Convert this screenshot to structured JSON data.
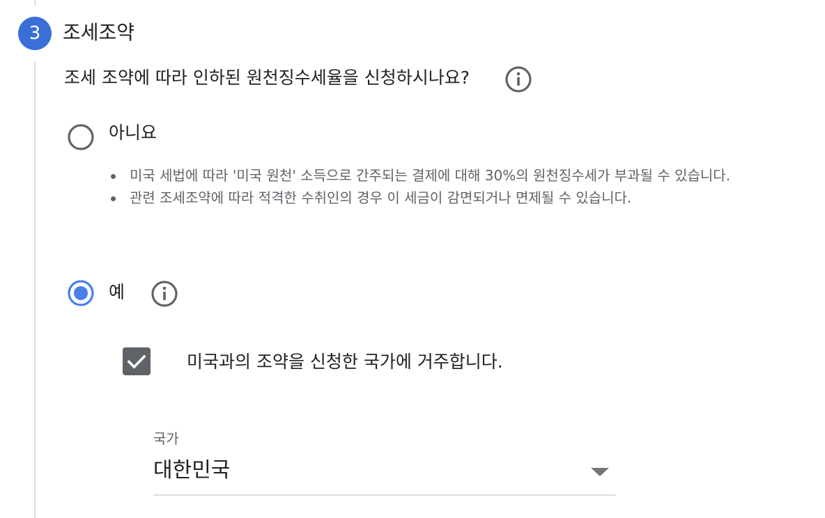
{
  "step": {
    "number": "3",
    "title": "조세조약"
  },
  "question": {
    "text": "조세 조약에 따라 인하된 원천징수세율을 신청하시나요?",
    "info_icon": "info-icon"
  },
  "options": {
    "no": {
      "label": "아니요",
      "selected": false,
      "notes": [
        "미국 세법에 따라 '미국 원천' 소득으로 간주되는 결제에 대해 30%의 원천징수세가 부과될 수 있습니다.",
        "관련 조세조약에 따라 적격한 수취인의 경우 이 세금이 감면되거나 면제될 수 있습니다."
      ]
    },
    "yes": {
      "label": "예",
      "selected": true,
      "info_icon": "info-icon"
    }
  },
  "residence_checkbox": {
    "label": "미국과의 조약을 신청한 국가에 거주합니다.",
    "checked": true
  },
  "country_select": {
    "caption": "국가",
    "value": "대한민국"
  },
  "colors": {
    "accent": "#3b6fd8",
    "radio_selected": "#4a7fe8",
    "text_primary": "#202124",
    "text_secondary": "#5f6368",
    "divider": "#dadce0"
  }
}
